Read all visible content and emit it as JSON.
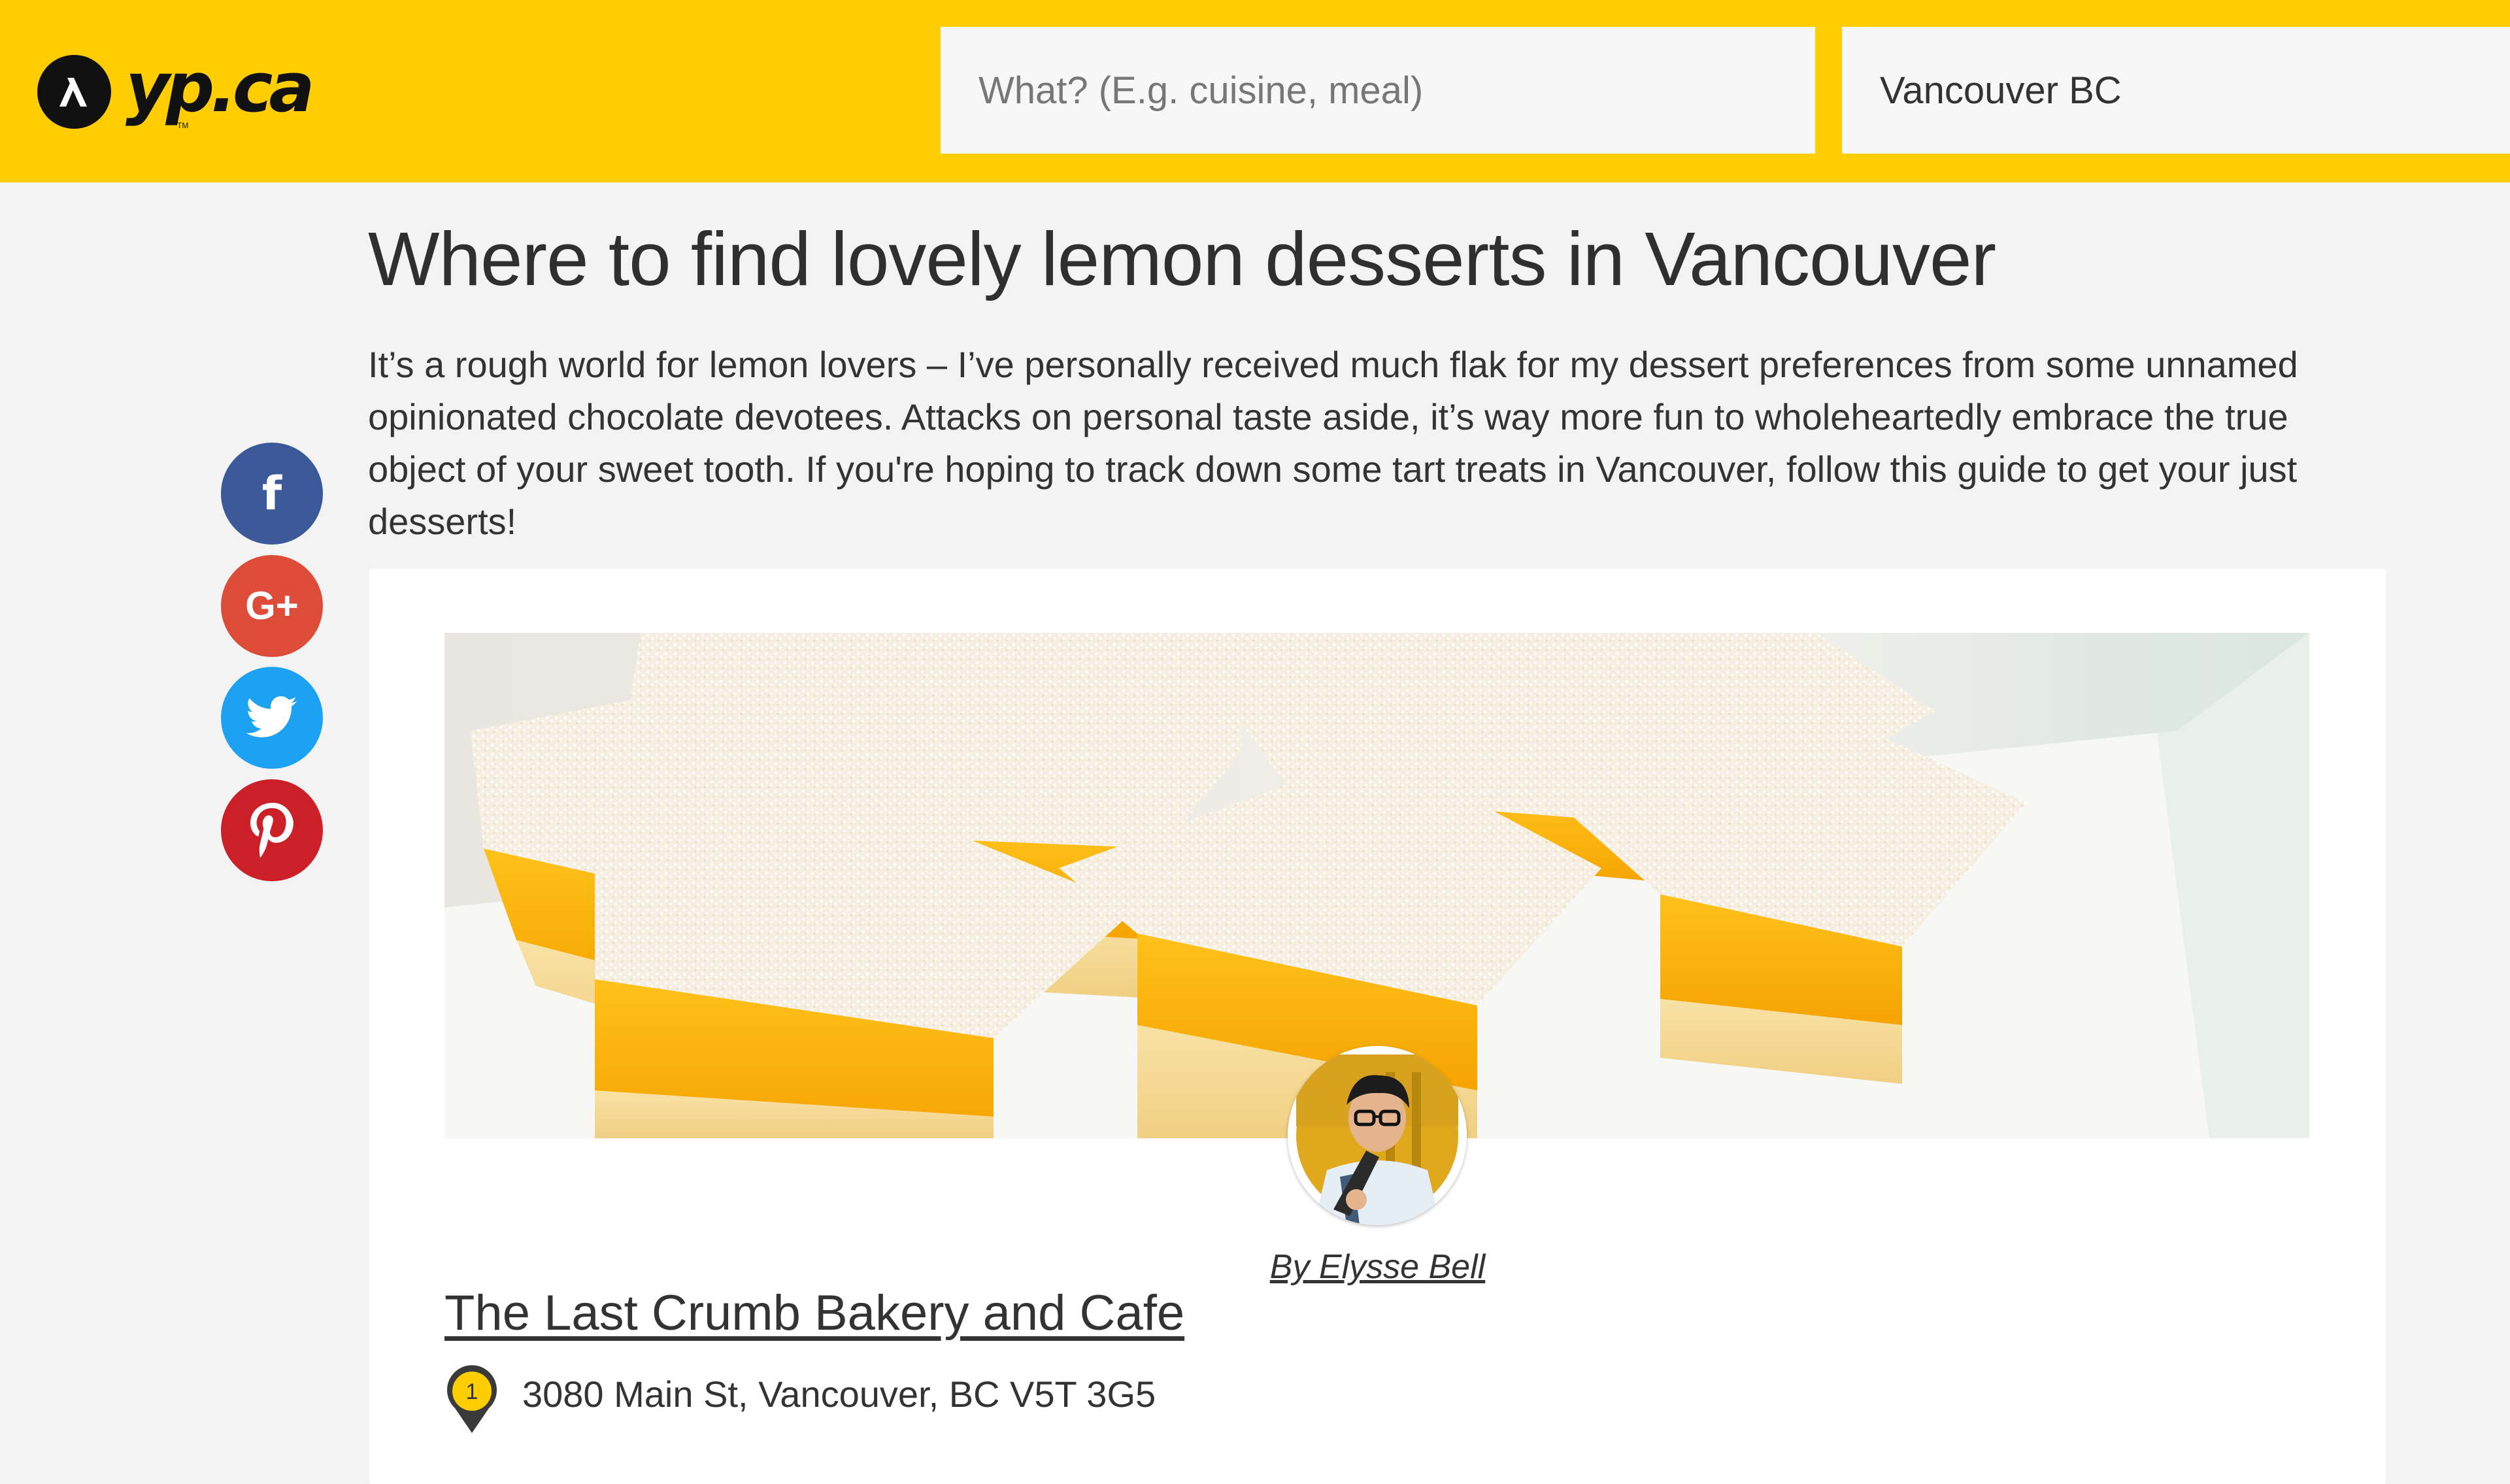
{
  "header": {
    "logo_text": "yp.ca",
    "logo_tm": "TM",
    "search_what": {
      "placeholder": "What? (E.g. cuisine, meal)",
      "value": ""
    },
    "search_where": {
      "value": "Vancouver BC"
    },
    "brand_color": "#ffcd00"
  },
  "article": {
    "title": "Where to find lovely lemon desserts in Vancouver",
    "intro": "It’s a rough world for lemon lovers – I’ve personally received much flak for my dessert preferences from some unnamed opinionated chocolate devotees. Attacks on personal taste aside, it’s way more fun to wholeheartedly embrace the true object of your sweet tooth. If you're hoping to track down some tart treats in Vancouver, follow this guide to get your just desserts!"
  },
  "social": [
    {
      "icon": "facebook-icon",
      "glyph": "f",
      "color": "#3b5998"
    },
    {
      "icon": "google-plus-icon",
      "glyph": "G+",
      "color": "#dd4b39"
    },
    {
      "icon": "twitter-icon",
      "glyph": "bird",
      "color": "#1da1f2"
    },
    {
      "icon": "pinterest-icon",
      "glyph": "P",
      "color": "#cb2027"
    }
  ],
  "card": {
    "hero_image": "lemon-squares-photo",
    "author": "By Elysse Bell",
    "business": {
      "number": "1",
      "name": "The Last Crumb Bakery and Cafe",
      "address": "3080 Main St, Vancouver, BC V5T 3G5"
    }
  }
}
